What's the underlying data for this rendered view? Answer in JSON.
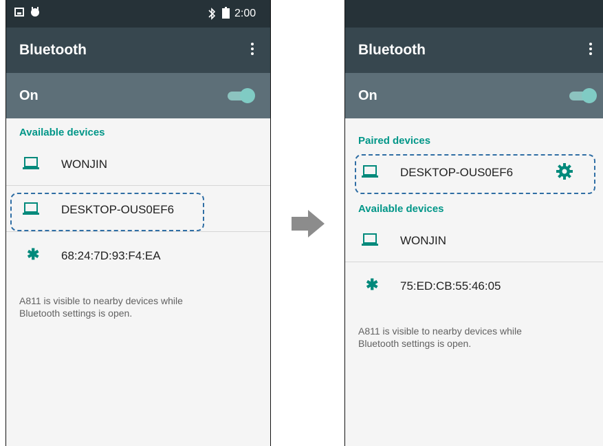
{
  "left_screen": {
    "status_time": "2:00",
    "title": "Bluetooth",
    "toggle_label": "On",
    "available_header": "Available devices",
    "devices": [
      {
        "name": "WONJIN",
        "icon": "laptop-icon"
      },
      {
        "name": "DESKTOP-OUS0EF6",
        "icon": "laptop-icon"
      },
      {
        "name": "68:24:7D:93:F4:EA",
        "icon": "bluetooth-icon"
      }
    ],
    "hint_line1": "A811 is visible to nearby devices while",
    "hint_line2": "Bluetooth settings is open."
  },
  "right_screen": {
    "title": "Bluetooth",
    "toggle_label": "On",
    "paired_header": "Paired devices",
    "paired_device": {
      "name": "DESKTOP-OUS0EF6",
      "icon": "laptop-icon"
    },
    "available_header": "Available devices",
    "devices": [
      {
        "name": "WONJIN",
        "icon": "laptop-icon"
      },
      {
        "name": "75:ED:CB:55:46:05",
        "icon": "bluetooth-icon"
      }
    ],
    "hint_line1": "A811 is visible to nearby devices while",
    "hint_line2": "Bluetooth settings is open."
  },
  "colors": {
    "accent": "#009688",
    "appbar": "#37474f",
    "highlight": "#2e6da4"
  }
}
